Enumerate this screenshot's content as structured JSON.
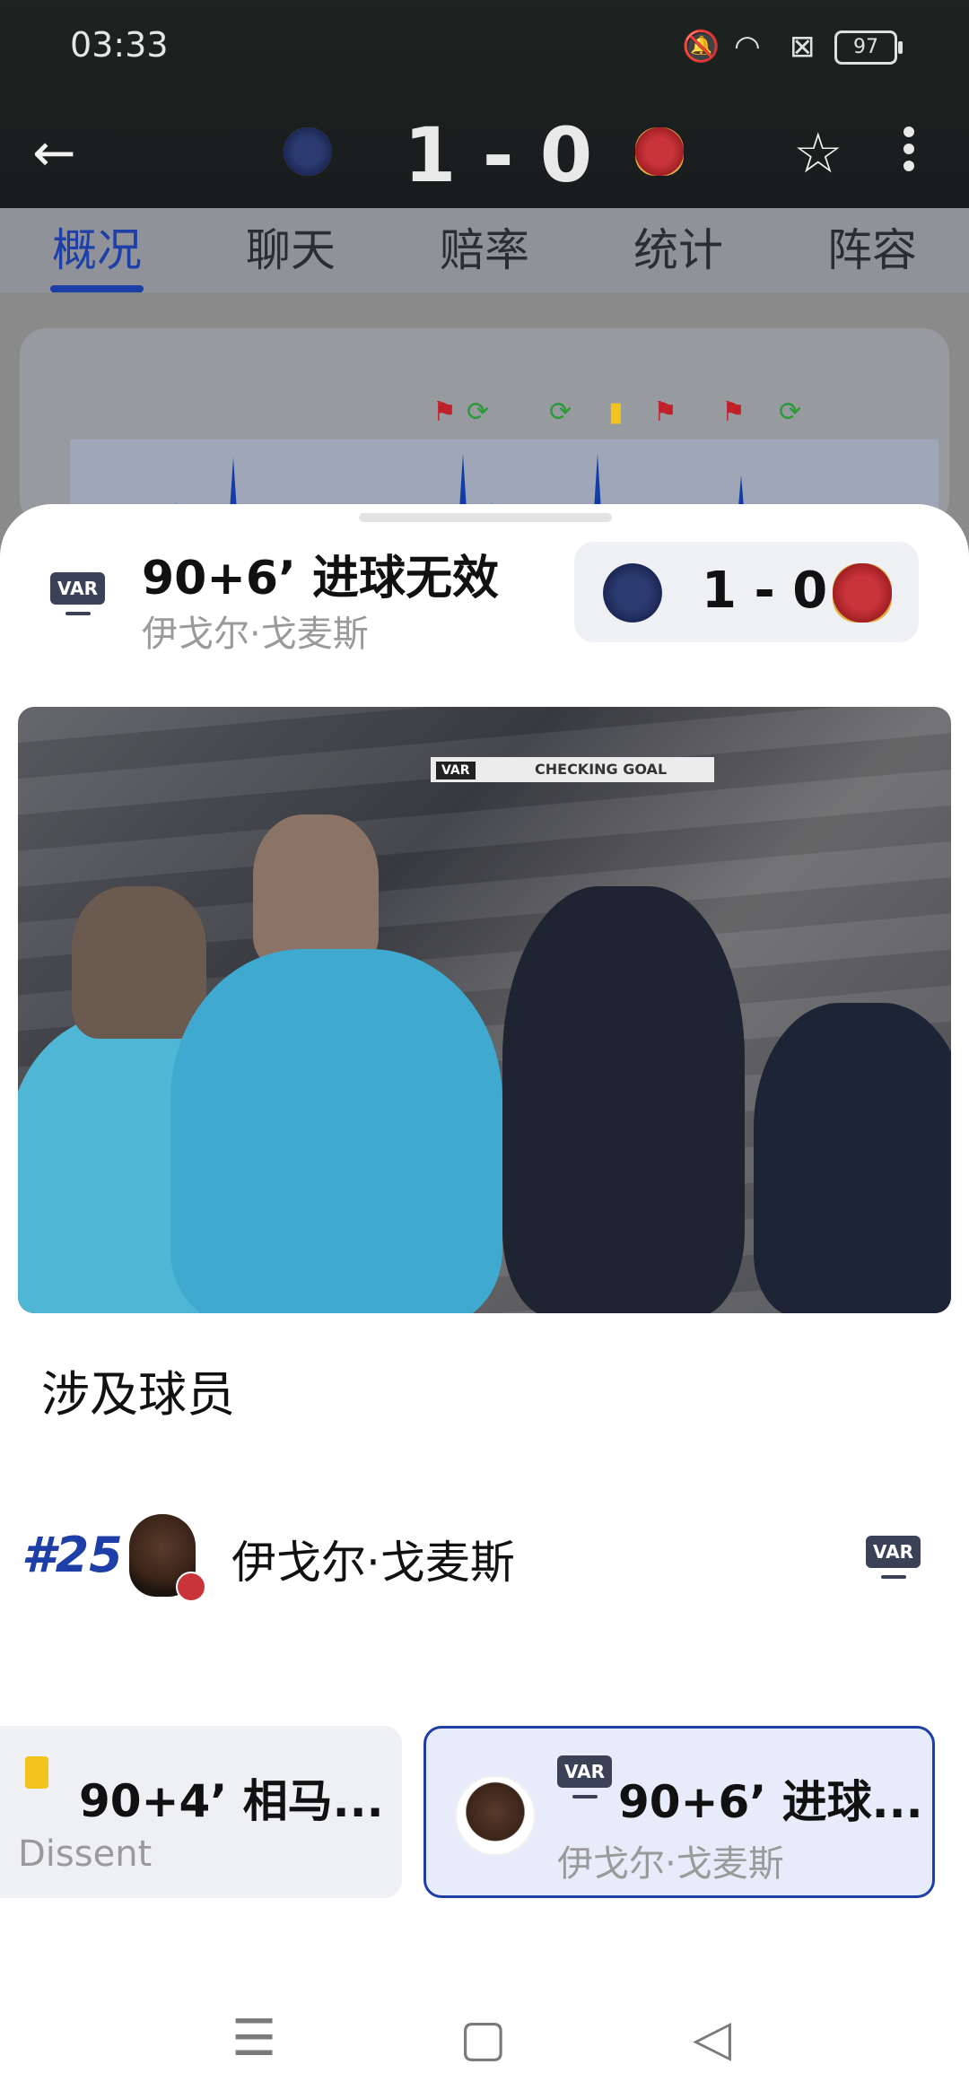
{
  "status_bar": {
    "time": "03:33",
    "battery": "97",
    "icons": [
      "mute-icon",
      "wifi-icon",
      "sim-off-icon",
      "battery-icon"
    ]
  },
  "match_header": {
    "score": "1 - 0",
    "home_team_logo": "zabeel-logo",
    "away_team_logo": "shabab-al-ahli-logo"
  },
  "tabs": [
    {
      "label": "概况",
      "active": true
    },
    {
      "label": "聊天",
      "active": false
    },
    {
      "label": "赔率",
      "active": false
    },
    {
      "label": "统计",
      "active": false
    },
    {
      "label": "阵容",
      "active": false
    }
  ],
  "event": {
    "badge": "VAR",
    "title": "90+6’ 进球无效",
    "player": "伊戈尔·戈麦斯",
    "score": "1 - 0"
  },
  "video": {
    "overlay_tag": "VAR",
    "overlay_text": "CHECKING GOAL"
  },
  "involved": {
    "section_title": "涉及球员",
    "players": [
      {
        "number": "#25",
        "name": "伊戈尔·戈麦斯",
        "badge": "VAR"
      }
    ]
  },
  "event_cards": [
    {
      "title": "90+4’ 相马...",
      "subtitle": "Dissent",
      "icon": "yellow-card-icon",
      "selected": false
    },
    {
      "title": "90+6’ 进球...",
      "subtitle": "伊戈尔·戈麦斯",
      "icon": "var-icon",
      "badge": "VAR",
      "selected": true
    }
  ],
  "colors": {
    "accent": "#1e3ea8",
    "yellow_card": "#f2c21d",
    "var_badge": "#3b4258"
  }
}
